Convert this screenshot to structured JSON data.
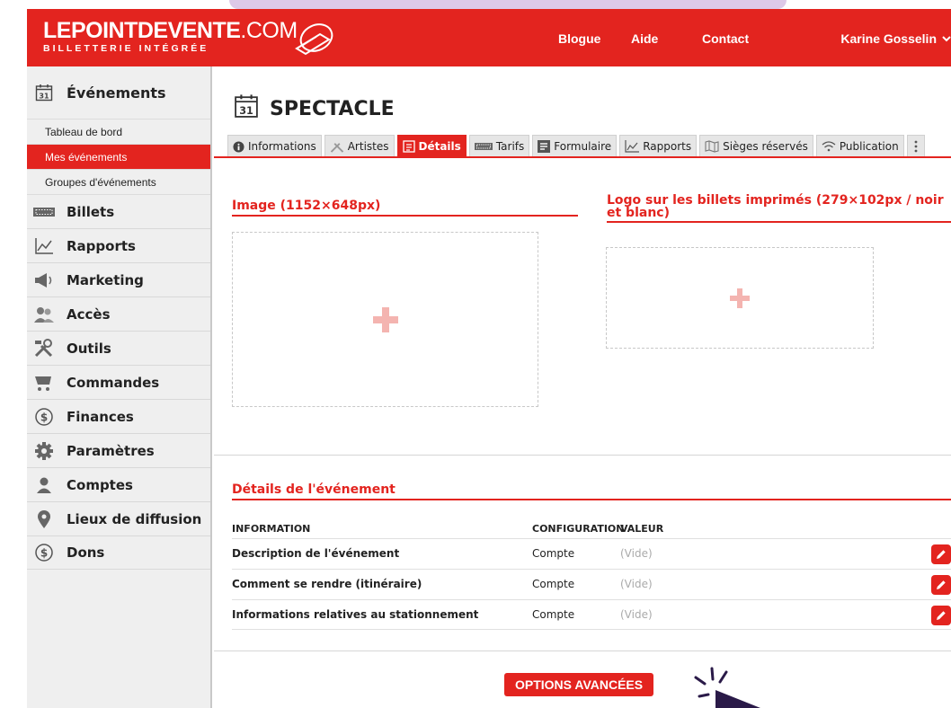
{
  "header": {
    "logo_bold": "LEPOINTDEVENTE",
    "logo_rest": ".COM",
    "logo_sub": "BILLETTERIE INTÉGRÉE",
    "nav": [
      "Blogue",
      "Aide",
      "Contact"
    ],
    "user": "Karine Gosselin",
    "color": "#e3241f"
  },
  "sidebar": {
    "section": "Événements",
    "sub_items": [
      "Tableau de bord",
      "Mes événements",
      "Groupes d'événements"
    ],
    "active_sub": "Mes événements",
    "items": [
      {
        "label": "Billets",
        "icon": "ticket-icon"
      },
      {
        "label": "Rapports",
        "icon": "chart-icon"
      },
      {
        "label": "Marketing",
        "icon": "megaphone-icon"
      },
      {
        "label": "Accès",
        "icon": "users-icon"
      },
      {
        "label": "Outils",
        "icon": "tools-icon"
      },
      {
        "label": "Commandes",
        "icon": "cart-icon"
      },
      {
        "label": "Finances",
        "icon": "dollar-icon"
      },
      {
        "label": "Paramètres",
        "icon": "gear-icon"
      },
      {
        "label": "Comptes",
        "icon": "user-icon"
      },
      {
        "label": "Lieux de diffusion",
        "icon": "location-pin-icon"
      },
      {
        "label": "Dons",
        "icon": "dollar-icon"
      }
    ]
  },
  "main": {
    "title": "SPECTACLE",
    "tabs": [
      {
        "label": "Informations",
        "icon": "info-icon"
      },
      {
        "label": "Artistes",
        "icon": "artist-icon"
      },
      {
        "label": "Détails",
        "icon": "details-icon",
        "active": true
      },
      {
        "label": "Tarifs",
        "icon": "ticket-icon"
      },
      {
        "label": "Formulaire",
        "icon": "form-icon"
      },
      {
        "label": "Rapports",
        "icon": "chart-icon"
      },
      {
        "label": "Sièges réservés",
        "icon": "seats-icon"
      },
      {
        "label": "Publication",
        "icon": "wifi-icon"
      },
      {
        "label": "",
        "icon": "more-vertical-icon"
      }
    ],
    "image_title": "Image (1152×648px)",
    "logo_title": "Logo sur les billets imprimés (279×102px / noir et blanc)",
    "details_title": "Détails de l'événement",
    "columns": [
      "INFORMATION",
      "CONFIGURATION",
      "VALEUR"
    ],
    "rows": [
      {
        "info": "Description de l'événement",
        "config": "Compte",
        "value": "(Vide)"
      },
      {
        "info": "Comment se rendre (itinéraire)",
        "config": "Compte",
        "value": "(Vide)"
      },
      {
        "info": "Informations relatives au stationnement",
        "config": "Compte",
        "value": "(Vide)"
      }
    ],
    "advanced_button": "OPTIONS AVANCÉES"
  }
}
